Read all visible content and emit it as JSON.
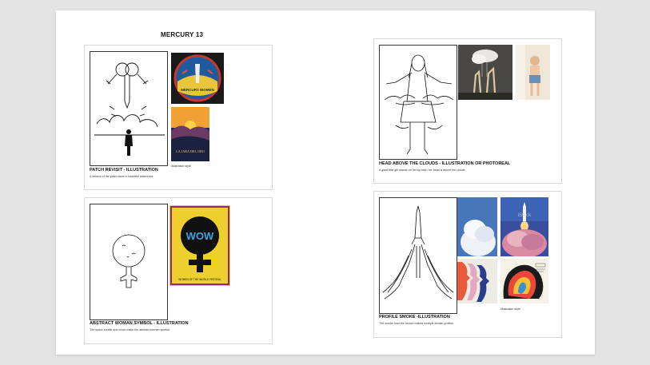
{
  "document": {
    "title": "MERCURY 13"
  },
  "cards": [
    {
      "title": "PATCH REVISIT - ILLUSTRATION",
      "description": "A version of the patch done in beautiful watercolor.",
      "caption": "Illustration style",
      "references": [
        "Mercury 13 mission patch",
        "La Jara del Oro poster"
      ],
      "patch_text": "MERCURY WOMEN",
      "poster_text": "LA JARA DEL ORO"
    },
    {
      "title": "HEAD ABOVE THE CLOUDS - ILLUSTRATION OR PHOTOREAL",
      "description": "A giant little girl stands on her tip toes, her head is above the clouds.",
      "references": [
        "Giraffes under a cloud photo",
        "Girl on tiptoes photo"
      ]
    },
    {
      "title": "ABSTRACT WOMAN SYMBOL - ILLUSTRATION",
      "description": "The space shuttle and moon make the abstract woman symbol.",
      "references": [
        "WOW poster"
      ],
      "poster_text": "WOW",
      "poster_footer": "WOMEN OF THE WORLD FESTIVAL"
    },
    {
      "title": "PROFILE SMOKE -ILLUSTRATION",
      "description": "The smoke from the launch makes multiple female profiles.",
      "caption": "Illustration style",
      "references": [
        "Cumulus cloud stock photo",
        "Rocket launch stock photo",
        "Female profiles illustration",
        "Psychedelic profile poster"
      ],
      "stock_watermark": "iStock"
    }
  ]
}
